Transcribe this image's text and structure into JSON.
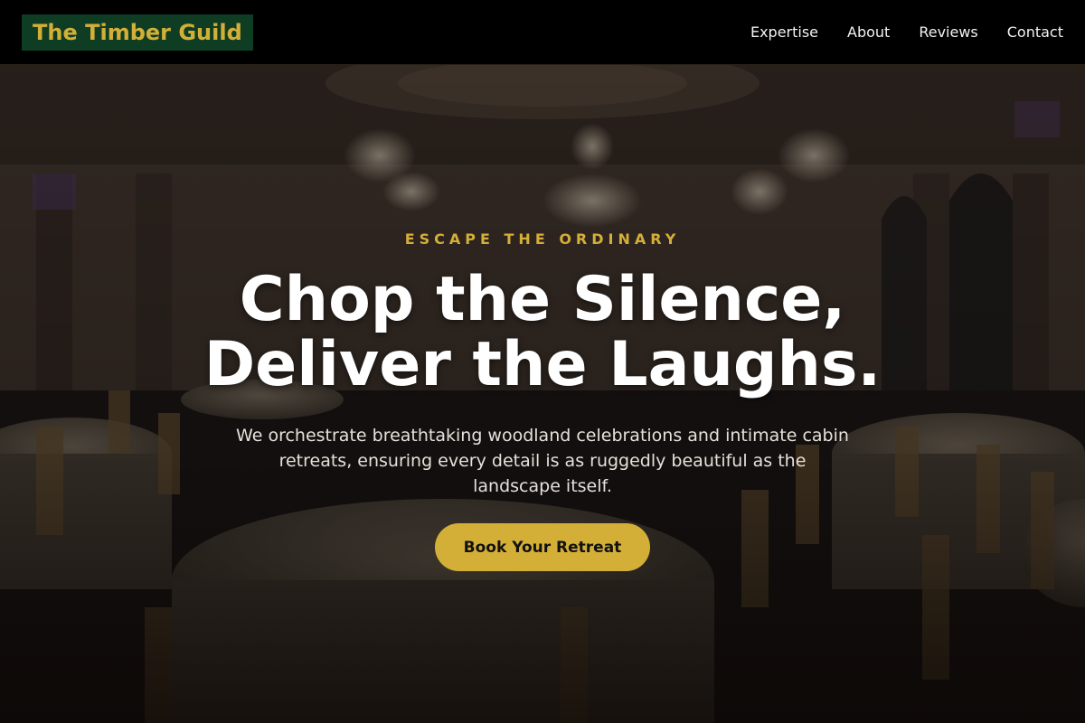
{
  "header": {
    "logo": "The Timber Guild",
    "nav": [
      "Expertise",
      "About",
      "Reviews",
      "Contact"
    ]
  },
  "hero": {
    "eyebrow": "ESCAPE THE ORDINARY",
    "headline_line1": "Chop the Silence,",
    "headline_line2": "Deliver the Laughs.",
    "subtext": "We orchestrate breathtaking woodland celebrations and intimate cabin retreats, ensuring every detail is as ruggedly beautiful as the landscape itself.",
    "cta_label": "Book Your Retreat",
    "background_image": "ballroom-banquet-hall-photo"
  },
  "colors": {
    "accent": "#d4af37",
    "logo_bg": "#0f3d24",
    "header_bg": "#000000"
  }
}
